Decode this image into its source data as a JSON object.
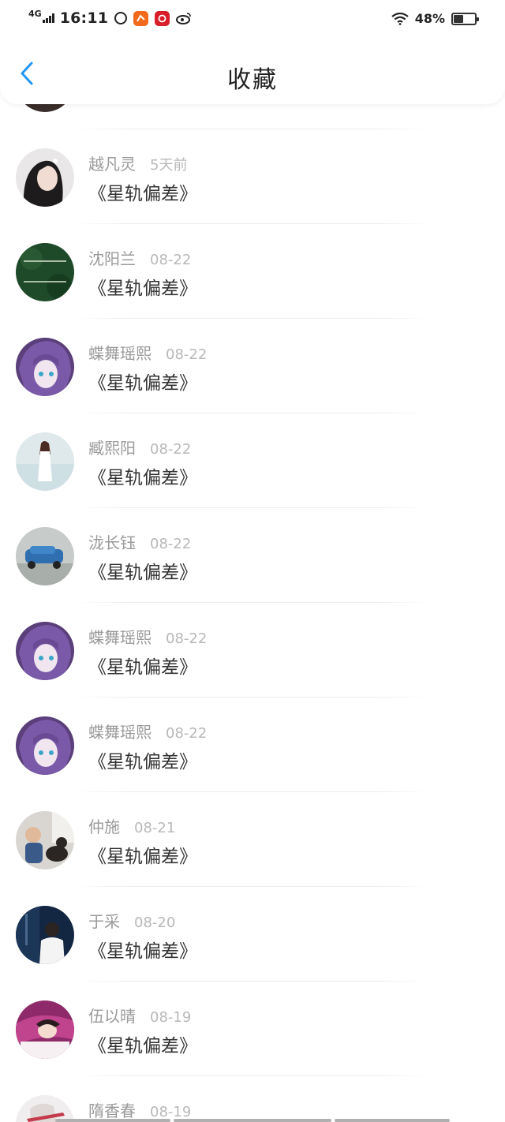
{
  "status_bar": {
    "network": "4G",
    "time": "16:11",
    "battery": "48%",
    "battery_level": 0.48
  },
  "nav": {
    "title": "收藏"
  },
  "items": [
    {
      "user": "越凡灵",
      "time": "5天前",
      "title": "《星轨偏差》"
    },
    {
      "user": "沈阳兰",
      "time": "08-22",
      "title": "《星轨偏差》"
    },
    {
      "user": "蝶舞瑶熙",
      "time": "08-22",
      "title": "《星轨偏差》"
    },
    {
      "user": "臧熙阳",
      "time": "08-22",
      "title": "《星轨偏差》"
    },
    {
      "user": "泷长钰",
      "time": "08-22",
      "title": "《星轨偏差》"
    },
    {
      "user": "蝶舞瑶熙",
      "time": "08-22",
      "title": "《星轨偏差》"
    },
    {
      "user": "蝶舞瑶熙",
      "time": "08-22",
      "title": "《星轨偏差》"
    },
    {
      "user": "仲施",
      "time": "08-21",
      "title": "《星轨偏差》"
    },
    {
      "user": "于采",
      "time": "08-20",
      "title": "《星轨偏差》"
    },
    {
      "user": "伍以晴",
      "time": "08-19",
      "title": "《星轨偏差》"
    },
    {
      "user": "隋香春",
      "time": "08-19",
      "title": ""
    }
  ],
  "colors": {
    "accent": "#2196f3",
    "username": "#9a9a9a",
    "time": "#b8b8b8",
    "title": "#333333"
  }
}
